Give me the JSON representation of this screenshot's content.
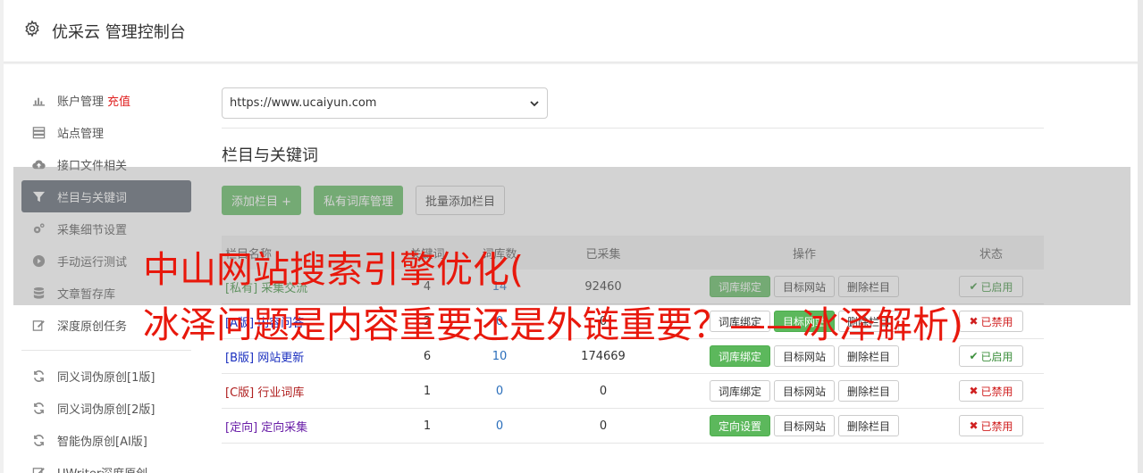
{
  "header": {
    "title": "优采云 管理控制台"
  },
  "sidebar": {
    "items": [
      {
        "label": "账户管理",
        "badge": "充值",
        "icon": "bar-chart-icon",
        "active": false
      },
      {
        "label": "站点管理",
        "icon": "server-icon",
        "active": false
      },
      {
        "label": "接口文件相关",
        "icon": "cloud-upload-icon",
        "active": false
      },
      {
        "label": "栏目与关键词",
        "icon": "filter-icon",
        "active": true
      },
      {
        "label": "采集细节设置",
        "icon": "cogs-icon",
        "active": false
      },
      {
        "label": "手动运行测试",
        "icon": "play-circle-icon",
        "active": false
      },
      {
        "label": "文章暂存库",
        "icon": "database-icon",
        "active": false
      },
      {
        "label": "深度原创任务",
        "icon": "edit-icon",
        "active": false
      }
    ],
    "items2": [
      {
        "label": "同义词伪原创[1版]",
        "icon": "refresh-icon"
      },
      {
        "label": "同义词伪原创[2版]",
        "icon": "refresh-icon"
      },
      {
        "label": "智能伪原创[AI版]",
        "icon": "refresh-icon"
      },
      {
        "label": "UWriter深度原创",
        "icon": "edit-icon"
      }
    ]
  },
  "main": {
    "site_select": "https://www.ucaiyun.com",
    "section_title": "栏目与关键词",
    "buttons": {
      "add": "添加栏目 +",
      "private_lib": "私有词库管理",
      "batch_add": "批量添加栏目"
    },
    "table": {
      "headers": {
        "name": "栏目名称",
        "kw_count": "关键词",
        "lib_count": "词库数",
        "collected": "已采集",
        "ops": "操作",
        "status": "状态"
      },
      "rows": [
        {
          "tag": "[私有]",
          "name": "采集交流",
          "kw": "4",
          "lib": "14",
          "collected": "92460",
          "op1": "词库绑定",
          "op1_green": true,
          "op2": "目标网站",
          "op2_green": false,
          "op3": "删除栏目",
          "status": "已启用",
          "on": true,
          "tag_class": "tag-green"
        },
        {
          "tag": "[A版]",
          "name": "内容问答",
          "kw": "2",
          "lib": "0",
          "collected": "0",
          "op1": "词库绑定",
          "op1_green": false,
          "op2": "目标网站",
          "op2_green": true,
          "op3": "删除栏目",
          "status": "已禁用",
          "on": false,
          "tag_class": "tag-blue"
        },
        {
          "tag": "[B版]",
          "name": "网站更新",
          "kw": "6",
          "lib": "10",
          "collected": "174669",
          "op1": "词库绑定",
          "op1_green": true,
          "op2": "目标网站",
          "op2_green": false,
          "op3": "删除栏目",
          "status": "已启用",
          "on": true,
          "tag_class": "tag-blue"
        },
        {
          "tag": "[C版]",
          "name": "行业词库",
          "kw": "1",
          "lib": "0",
          "collected": "0",
          "op1": "词库绑定",
          "op1_green": false,
          "op2": "目标网站",
          "op2_green": false,
          "op3": "删除栏目",
          "status": "已禁用",
          "on": false,
          "tag_class": "tag-red"
        },
        {
          "tag": "[定向]",
          "name": "定向采集",
          "kw": "1",
          "lib": "0",
          "collected": "0",
          "op1": "定向设置",
          "op1_green": true,
          "op2": "目标网站",
          "op2_green": false,
          "op3": "删除栏目",
          "status": "已禁用",
          "on": false,
          "tag_class": "tag-purple"
        }
      ]
    }
  },
  "overlay": {
    "line1": "中山网站搜索引擎优化(",
    "line2": "冰泽问题是内容重要还是外链重要？——冰泽解析)"
  },
  "colors": {
    "accent_green": "#5cb85c",
    "active_nav": "#58616d",
    "danger": "#e02020",
    "overlay_text": "#e8180c"
  }
}
